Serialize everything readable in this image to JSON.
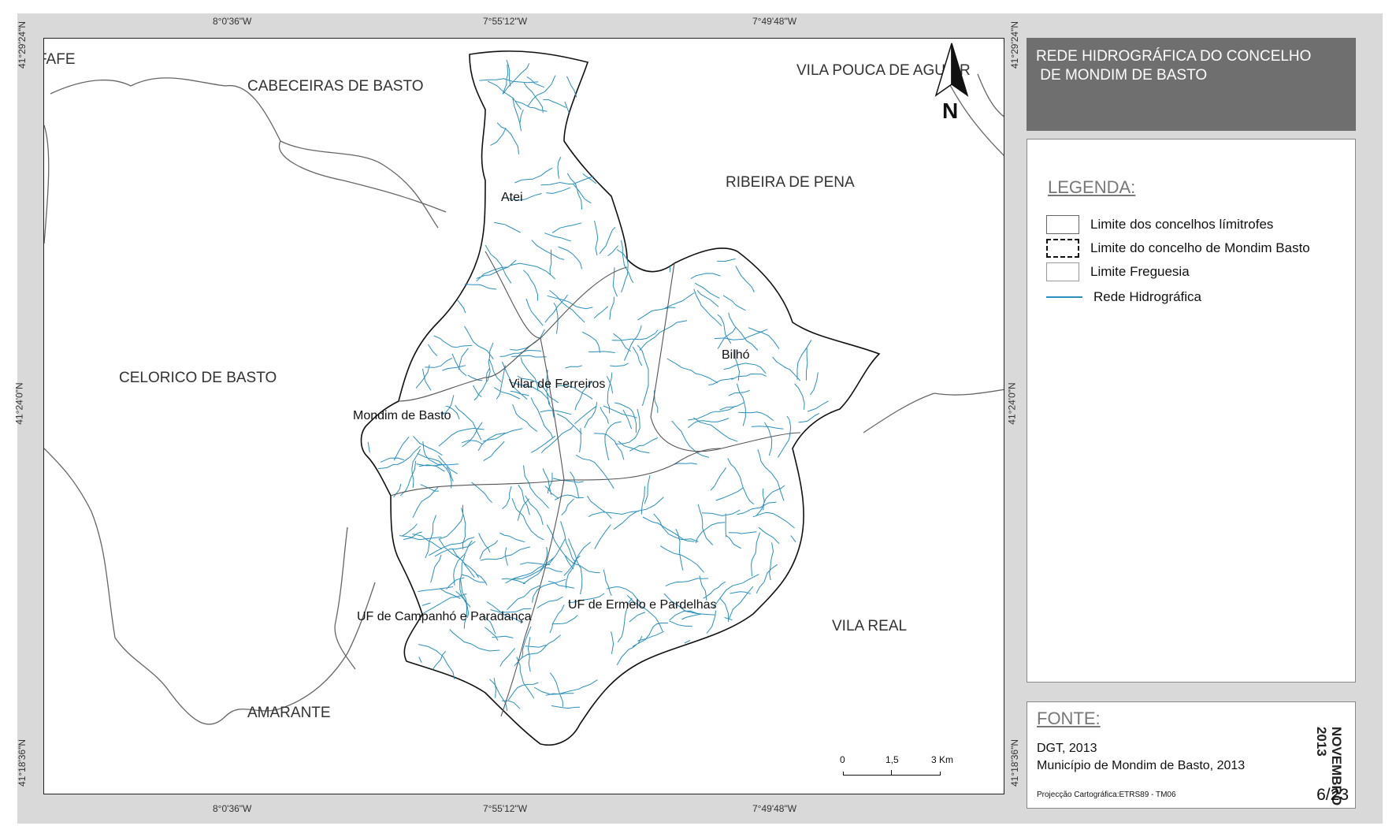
{
  "map": {
    "coords_top": [
      "8°0'36\"W",
      "7°55'12\"W",
      "7°49'48\"W"
    ],
    "coords_bottom": [
      "8°0'36\"W",
      "7°55'12\"W",
      "7°49'48\"W"
    ],
    "coords_left": [
      "41°29'24\"N",
      "41°24'0\"N",
      "41°18'36\"N"
    ],
    "coords_right": [
      "41°29'24\"N",
      "41°24'0\"N",
      "41°18'36\"N"
    ],
    "neighbors": [
      "FAFE",
      "CABECEIRAS DE BASTO",
      "VILA POUCA DE AGUIAR",
      "RIBEIRA DE PENA",
      "CELORICO DE BASTO",
      "VILA REAL",
      "AMARANTE"
    ],
    "parishes": [
      "Atei",
      "Bilhó",
      "Vilar de Ferreiros",
      "Mondim de Basto",
      "UF de Campanhó e Paradança",
      "UF de Ermelo e Pardelhas"
    ],
    "north_label": "N",
    "scale": {
      "labels": [
        "0",
        "1,5",
        "3 Km"
      ]
    },
    "colors": {
      "river": "#2a8fbd",
      "boundary": "#666666",
      "municipality": "#111111"
    }
  },
  "title": {
    "line1": "REDE HIDROGRÁFICA DO CONCELHO",
    "line2": " DE MONDIM DE BASTO"
  },
  "legend": {
    "title": "LEGENDA:",
    "items": [
      {
        "label": "Limite dos concelhos límitrofes",
        "symbol": "box-solid"
      },
      {
        "label": "Limite do concelho de Mondim Basto",
        "symbol": "box-dashed"
      },
      {
        "label": "Limite Freguesia",
        "symbol": "box-thin"
      },
      {
        "label": "Rede Hidrográfica",
        "symbol": "line-blue"
      }
    ]
  },
  "source": {
    "title": "FONTE:",
    "lines": [
      "DGT, 2013",
      "Município de Mondim de Basto, 2013"
    ],
    "projection": "Projecção Cartográfica:ETRS89 - TM06",
    "date": "NOVEMBRO\n2013",
    "page": "6/23"
  }
}
